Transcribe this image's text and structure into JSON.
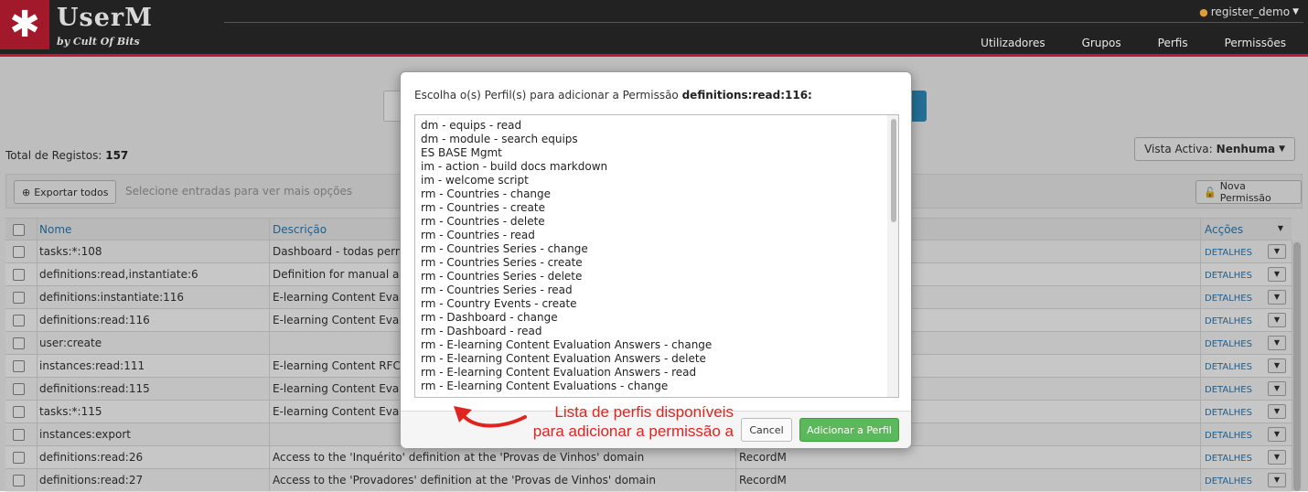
{
  "app": {
    "logo_glyph": "✱",
    "name": "UserM",
    "subtitle": "by Cult Of Bits",
    "user": "register_demo",
    "nav": [
      "Utilizadores",
      "Grupos",
      "Perfis",
      "Permissões"
    ]
  },
  "page": {
    "total_label": "Total de Registos:",
    "total_value": "157",
    "vista_label": "Vista Activa:",
    "vista_value": "Nenhuma",
    "export_label": "Exportar todos",
    "toolbar_hint": "Selecione entradas para ver mais opções",
    "new_perm_label": "Nova Permissão",
    "columns": {
      "name": "Nome",
      "desc": "Descrição",
      "actions": "Acções"
    },
    "rows": [
      {
        "name": "tasks:*:108",
        "desc": "Dashboard - todas perms s",
        "product": ""
      },
      {
        "name": "definitions:read,instantiate:6",
        "desc": "Definition for manual and",
        "product": ""
      },
      {
        "name": "definitions:instantiate:116",
        "desc": "E-learning Content Evalua",
        "product": ""
      },
      {
        "name": "definitions:read:116",
        "desc": "E-learning Content Evalua",
        "product": ""
      },
      {
        "name": "user:create",
        "desc": "",
        "product": ""
      },
      {
        "name": "instances:read:111",
        "desc": "E-learning Content RFCs -",
        "product": ""
      },
      {
        "name": "definitions:read:115",
        "desc": "E-learning Content Evalua",
        "product": ""
      },
      {
        "name": "tasks:*:115",
        "desc": "E-learning Content Evalua",
        "product": ""
      },
      {
        "name": "instances:export",
        "desc": "",
        "product": ""
      },
      {
        "name": "definitions:read:26",
        "desc": "Access to the 'Inquérito' definition at the 'Provas de Vinhos' domain",
        "product": "RecordM"
      },
      {
        "name": "definitions:read:27",
        "desc": "Access to the 'Provadores' definition at the 'Provas de Vinhos' domain",
        "product": "RecordM"
      }
    ],
    "details_label": "DETALHES"
  },
  "modal": {
    "title_prefix": "Escolha o(s) Perfil(s) para adicionar a Permissão",
    "title_perm": "definitions:read:116:",
    "profiles": [
      "dm - equips - read",
      "dm - module - search equips",
      "ES BASE Mgmt",
      "im - action - build docs markdown",
      "im - welcome script",
      "rm - Countries - change",
      "rm - Countries - create",
      "rm - Countries - delete",
      "rm - Countries - read",
      "rm - Countries Series - change",
      "rm - Countries Series - create",
      "rm - Countries Series - delete",
      "rm - Countries Series - read",
      "rm - Country Events - create",
      "rm - Dashboard - change",
      "rm - Dashboard - read",
      "rm - E-learning Content Evaluation Answers - change",
      "rm - E-learning Content Evaluation Answers - delete",
      "rm - E-learning Content Evaluation Answers - read",
      "rm - E-learning Content Evaluations - change"
    ],
    "cancel_label": "Cancel",
    "add_label": "Adicionar a Perfil"
  },
  "annotation": {
    "line1": "Lista de perfis disponíveis",
    "line2": "para adicionar a permissão a",
    "color": "#e0241f"
  }
}
